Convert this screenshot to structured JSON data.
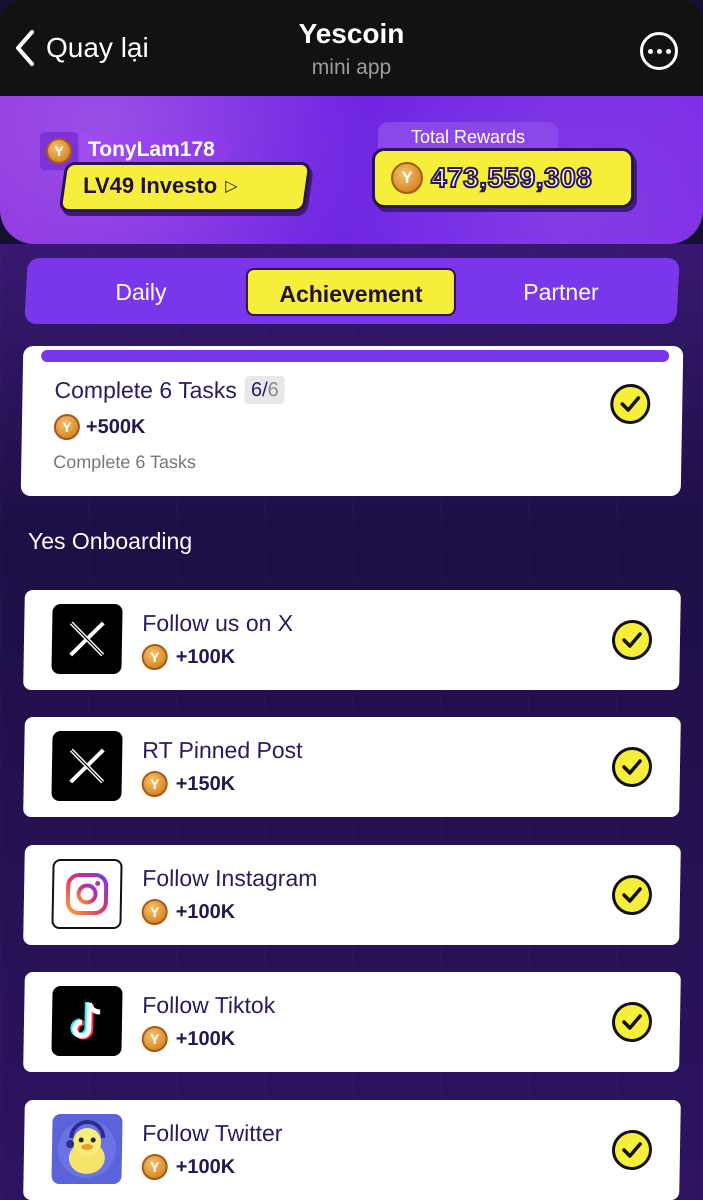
{
  "nav": {
    "back_label": "Quay lại",
    "title": "Yescoin",
    "subtitle": "mini app"
  },
  "profile": {
    "username": "TonyLam178",
    "level": "LV49 Investo"
  },
  "rewards": {
    "label": "Total Rewards",
    "value": "473,559,308"
  },
  "tabs": [
    {
      "label": "Daily",
      "active": false
    },
    {
      "label": "Achievement",
      "active": true
    },
    {
      "label": "Partner",
      "active": false
    }
  ],
  "summary": {
    "title": "Complete 6 Tasks",
    "count_done": "6",
    "count_sep": "/",
    "count_total": "6",
    "reward": "+500K",
    "description": "Complete 6 Tasks",
    "progress": 1.0
  },
  "section_title": "Yes Onboarding",
  "tasks": [
    {
      "name": "Follow us on X",
      "reward": "+100K",
      "icon": "x-logo-icon"
    },
    {
      "name": "RT Pinned Post",
      "reward": "+150K",
      "icon": "x-logo-icon"
    },
    {
      "name": "Follow Instagram",
      "reward": "+100K",
      "icon": "instagram-icon"
    },
    {
      "name": "Follow Tiktok",
      "reward": "+100K",
      "icon": "tiktok-icon"
    },
    {
      "name": "Follow Twitter",
      "reward": "+100K",
      "icon": "duck-avatar-icon"
    }
  ],
  "colors": {
    "accent_purple": "#7a36ea",
    "accent_yellow": "#f5ee3a",
    "text_dark": "#2a1a60"
  }
}
